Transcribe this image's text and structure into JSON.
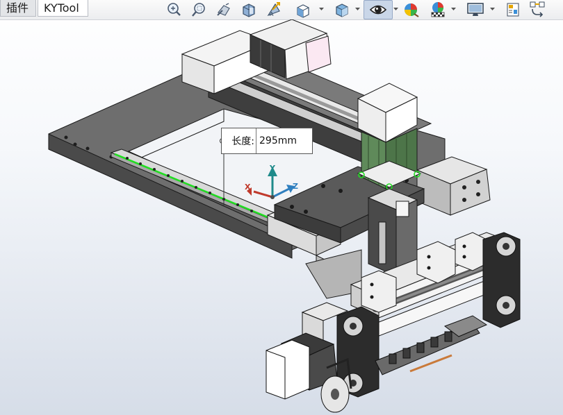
{
  "tabs": [
    {
      "label": "插件"
    },
    {
      "label": "KYTool"
    }
  ],
  "toolbar": {
    "icons": [
      "zoom-to-fit-icon",
      "zoom-to-area-icon",
      "previous-view-icon",
      "section-view-icon",
      "dynamic-annotation-icon",
      "view-orientation-icon",
      "display-style-icon",
      "hide-show-items-icon",
      "edit-appearance-icon",
      "apply-scene-icon",
      "view-settings-icon",
      "sheet-format-icon",
      "copy-settings-icon"
    ]
  },
  "dimension": {
    "label": "长度:",
    "value": "295mm"
  },
  "triad": {
    "x": "X",
    "y": "Y",
    "z": "Z"
  },
  "colors": {
    "highlight_green": "#22dd22",
    "motor_green": "#5f8a5a",
    "axis_x": "#c0392b",
    "axis_y": "#1f8a8a",
    "axis_z": "#2f7fbf"
  }
}
